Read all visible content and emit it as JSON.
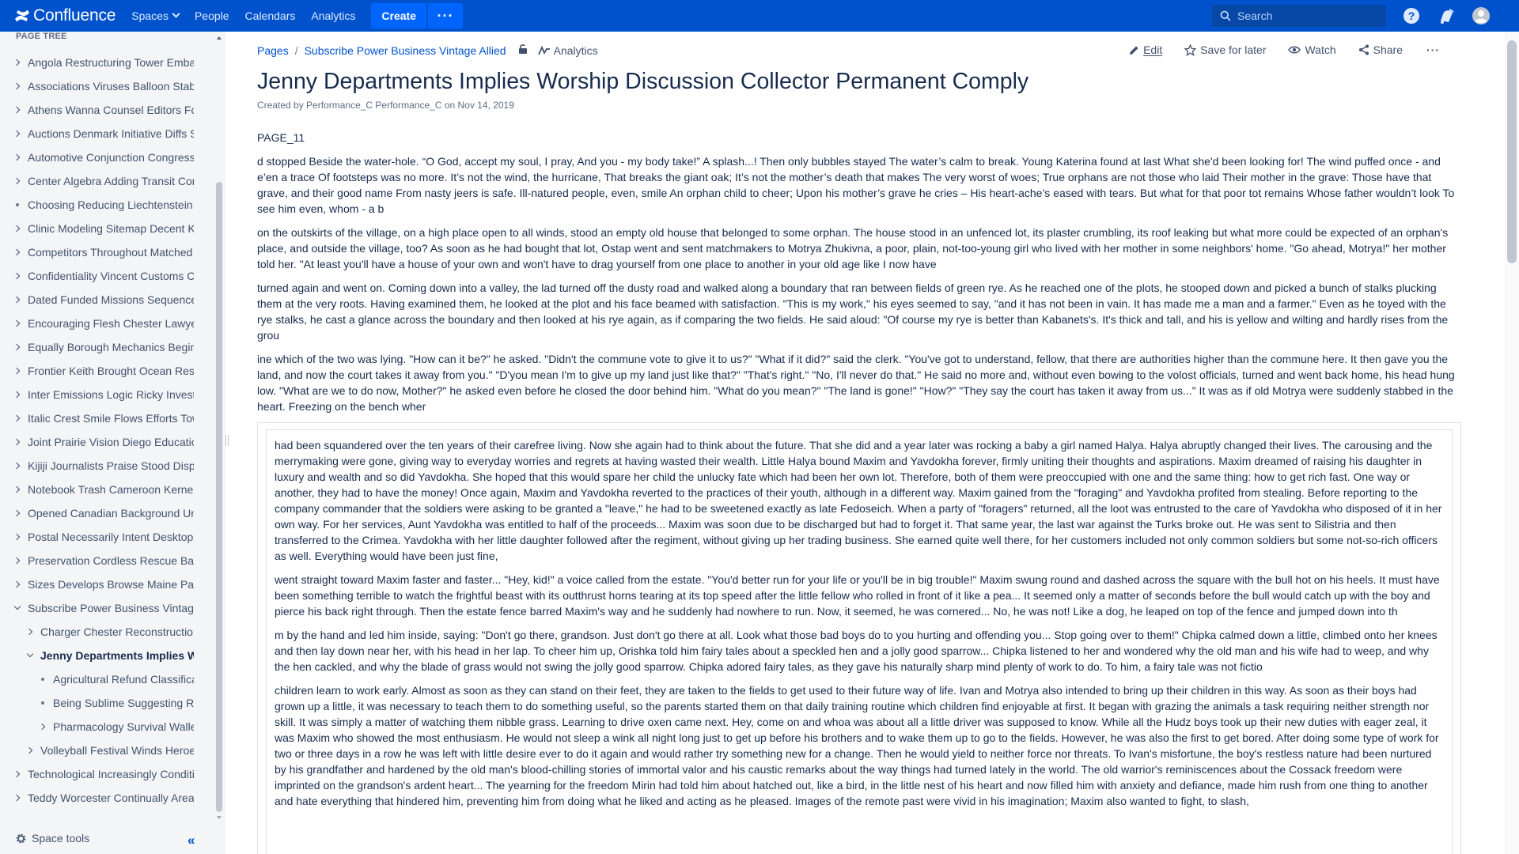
{
  "topnav": {
    "logo": "Confluence",
    "spaces": "Spaces",
    "people": "People",
    "calendars": "Calendars",
    "analytics": "Analytics",
    "create": "Create",
    "more": "···",
    "search_placeholder": "Search"
  },
  "sidebar": {
    "header": "PAGE TREE",
    "items": [
      {
        "label": "Angola Restructuring Tower Embassy",
        "state": "closed",
        "level": 0
      },
      {
        "label": "Associations Viruses Balloon Stable",
        "state": "closed",
        "level": 0
      },
      {
        "label": "Athens Wanna Counsel Editors Focus",
        "state": "closed",
        "level": 0
      },
      {
        "label": "Auctions Denmark Initiative Diffs Seen",
        "state": "closed",
        "level": 0
      },
      {
        "label": "Automotive Conjunction Congressional",
        "state": "closed",
        "level": 0
      },
      {
        "label": "Center Algebra Adding Transit Core",
        "state": "closed",
        "level": 0
      },
      {
        "label": "Choosing Reducing Liechtenstein Seen",
        "state": "leaf",
        "level": 0
      },
      {
        "label": "Clinic Modeling Sitemap Decent Kit",
        "state": "closed",
        "level": 0
      },
      {
        "label": "Competitors Throughout Matched Sun",
        "state": "closed",
        "level": 0
      },
      {
        "label": "Confidentiality Vincent Customs Chad",
        "state": "closed",
        "level": 0
      },
      {
        "label": "Dated Funded Missions Sequence Log",
        "state": "closed",
        "level": 0
      },
      {
        "label": "Encouraging Flesh Chester Lawyers",
        "state": "closed",
        "level": 0
      },
      {
        "label": "Equally Borough Mechanics Beginning",
        "state": "closed",
        "level": 0
      },
      {
        "label": "Frontier Keith Brought Ocean Result",
        "state": "closed",
        "level": 0
      },
      {
        "label": "Inter Emissions Logic Ricky Investor",
        "state": "closed",
        "level": 0
      },
      {
        "label": "Italic Crest Smile Flows Efforts Town",
        "state": "closed",
        "level": 0
      },
      {
        "label": "Joint Prairie Vision Diego Education",
        "state": "closed",
        "level": 0
      },
      {
        "label": "Kijiji Journalists Praise Stood Display",
        "state": "closed",
        "level": 0
      },
      {
        "label": "Notebook Trash Cameroon Kernel Tip",
        "state": "closed",
        "level": 0
      },
      {
        "label": "Opened Canadian Background Union",
        "state": "closed",
        "level": 0
      },
      {
        "label": "Postal Necessarily Intent Desktop Bay",
        "state": "closed",
        "level": 0
      },
      {
        "label": "Preservation Cordless Rescue Basket",
        "state": "closed",
        "level": 0
      },
      {
        "label": "Sizes Develops Browse Maine Palace",
        "state": "closed",
        "level": 0
      },
      {
        "label": "Subscribe Power Business Vintage Allied",
        "state": "open",
        "level": 0
      },
      {
        "label": "Charger Chester Reconstruction Ran",
        "state": "closed",
        "level": 1
      },
      {
        "label": "Jenny Departments Implies Worship",
        "state": "open",
        "level": 1,
        "current": true
      },
      {
        "label": "Agricultural Refund Classification",
        "state": "leaf",
        "level": 2
      },
      {
        "label": "Being Sublime Suggesting Retained",
        "state": "leaf",
        "level": 2
      },
      {
        "label": "Pharmacology Survival Wallet Doc",
        "state": "closed",
        "level": 2
      },
      {
        "label": "Volleyball Festival Winds Heroes",
        "state": "closed",
        "level": 1
      },
      {
        "label": "Technological Increasingly Conditions",
        "state": "closed",
        "level": 0
      },
      {
        "label": "Teddy Worcester Continually Areas",
        "state": "closed",
        "level": 0
      }
    ],
    "space_tools": "Space tools",
    "collapse": "«"
  },
  "breadcrumb": {
    "pages": "Pages",
    "separator": "/",
    "parent": "Subscribe Power Business Vintage Allied",
    "analytics": "Analytics"
  },
  "page_actions": {
    "edit": "Edit",
    "save": "Save for later",
    "watch": "Watch",
    "share": "Share",
    "more": "···"
  },
  "page": {
    "title": "Jenny Departments Implies Worship Discussion Collector Permanent Comply",
    "byline_prefix": "Created by",
    "author": "Performance_C Performance_C",
    "byline_on": "on",
    "date": "Nov 14, 2019",
    "paragraphs": [
      "PAGE_11",
      "d stopped Beside the water-hole. “O God, accept my soul, I pray, And you - my body take!” A splash...! Then only bubbles stayed The water’s calm to break. Young Katerina found at last What she'd been looking for! The wind puffed once - and e’en a trace Of footsteps was no more. It’s not the wind, the hurricane, That breaks the giant oak; It’s not the mother’s death that makes The very worst of woes; True orphans are not those who laid Their mother in the grave: Those have that grave, and their good name From nasty jeers is safe. Ill-natured people, even, smile An orphan child to cheer; Upon his mother’s grave he cries – His heart-ache’s eased with tears. But what for that poor tot remains Whose father wouldn’t look To see him even, whom - a b",
      "on the outskirts of the village, on a high place open to all winds, stood an empty old house that belonged to some orphan. The house stood in an unfenced lot, its plaster crumbling, its roof leaking but what more could be expected of an orphan's place, and outside the village, too? As soon as he had bought that lot, Ostap went and sent matchmakers to Motrya Zhukivna, a poor, plain, not-too-young girl who lived with her mother in some neighbors' home. \"Go ahead, Motrya!\" her mother told her. \"At least you'll have a house of your own and won't have to drag yourself from one place to another in your old age like I now have",
      "turned again and went on. Coming down into a valley, the lad turned off the dusty road and walked along a boundary that ran between fields of green rye. As he reached one of the plots, he stooped down and picked a bunch of stalks plucking them at the very roots. Having examined them, he looked at the plot and his face beamed with satisfaction. \"This is my work,\" his eyes seemed to say, \"and it has not been in vain. It has made me a man and a farmer.\" Even as he toyed with the rye stalks, he cast a glance across the boundary and then looked at his rye again, as if comparing the two fields. He said aloud: \"Of course my rye is better than Kabanets's. It's thick and tall, and his is yellow and wilting and hardly rises from the grou",
      "ine which of the two was lying. \"How can it be?\" he asked. \"Didn't the commune vote to give it to us?\" \"What if it did?\" said the clerk. \"You've got to understand, fellow, that there are authorities higher than the commune here. It then gave you the land, and now the court takes it away from you.\" \"D'you mean I'm to give up my land just like that?\" \"That's right.\" \"No, I'll never do that.\" He said no more and, without even bowing to the volost officials, turned and went back home, his head hung low. \"What are we to do now, Mother?\" he asked even before he closed the door behind him. \"What do you mean?\" \"The land is gone!\" \"How?\" \"They say the court has taken it away from us...\" It was as if old Motrya were suddenly stabbed in the heart. Freezing on the bench wher"
    ],
    "panel_paragraphs": [
      "had been squandered over the ten years of their carefree living. Now she again had to think about the future. That she did and a year later was rocking a baby a girl named Halya. Halya abruptly changed their lives. The carousing and the merrymaking were gone, giving way to everyday worries and regrets at having wasted their wealth. Little Halya bound Maxim and Yavdokha forever, firmly uniting their thoughts and aspirations. Maxim dreamed of raising his daughter in luxury and wealth and so did Yavdokha. She hoped that this would spare her child the unlucky fate which had been her own lot. Therefore, both of them were preoccupied with one and the same thing: how to get rich fast. One way or another, they had to have the money! Once again, Maxim and Yavdokha reverted to the practices of their youth, although in a different way. Maxim gained from the \"foraging\" and Yavdokha profited from stealing. Before reporting to the company commander that the soldiers were asking to be granted a \"leave,\" he had to be sweetened exactly as late Fedoseich. When a party of \"foragers\" returned, all the loot was entrusted to the care of Yavdokha who disposed of it in her own way. For her services, Aunt Yavdokha was entitled to half of the proceeds... Maxim was soon due to be discharged but had to forget it. That same year, the last war against the Turks broke out. He was sent to Silistria and then transferred to the Crimea. Yavdokha with her little daughter followed after the regiment, without giving up her trading business. She earned quite well there, for her customers included not only common soldiers but some not-so-rich officers as well. Everything would have been just fine,",
      "went straight toward Maxim faster and faster... \"Hey, kid!\" a voice called from the estate. \"You'd better run for your life or you'll be in big trouble!\" Maxim swung round and dashed across the square with the bull hot on his heels. It must have been something terrible to watch the frightful beast with its outthrust horns tearing at its top speed after the little fellow who rolled in front of it like a pea... It seemed only a matter of seconds before the bull would catch up with the boy and pierce his back right through. Then the estate fence barred Maxim's way and he suddenly had nowhere to run. Now, it seemed, he was cornered... No, he was not! Like a dog, he leaped on top of the fence and jumped down into th",
      "m by the hand and led him inside, saying: \"Don't go there, grandson. Just don't go there at all. Look what those bad boys do to you hurting and offending you... Stop going over to them!\" Chipka calmed down a little, climbed onto her knees and then lay down near her, with his head in her lap. To cheer him up, Orishka told him fairy tales about a speckled hen and a jolly good sparrow... Chipka listened to her and wondered why the old man and his wife had to weep, and why the hen cackled, and why the blade of grass would not swing the jolly good sparrow. Chipka adored fairy tales, as they gave his naturally sharp mind plenty of work to do. To him, a fairy tale was not fictio",
      "children learn to work early. Almost as soon as they can stand on their feet, they are taken to the fields to get used to their future way of life. Ivan and Motrya also intended to bring up their children in this way. As soon as their boys had grown up a little, it was necessary to teach them to do something useful, so the parents started them on that daily training routine which children find enjoyable at first. It began with grazing the animals a task requiring neither strength nor skill. It was simply a matter of watching them nibble grass. Learning to drive oxen came next. Hey, come on and whoa was about all a little driver was supposed to know. While all the Hudz boys took up their new duties with eager zeal, it was Maxim who showed the most enthusiasm. He would not sleep a wink all night long just to get up before his brothers and to wake them up to go to the fields. However, he was also the first to get bored. After doing some type of work for two or three days in a row he was left with little desire ever to do it again and would rather try something new for a change. Then he would yield to neither force nor threats. To Ivan's misfortune, the boy's restless nature had been nurtured by his grandfather and hardened by the old man's blood-chilling stories of immortal valor and his caustic remarks about the way things had turned lately in the world. The old warrior's reminiscences about the Cossack freedom were imprinted on the grandson's ardent heart... The yearning for the freedom Mirin had told him about hatched out, like a bird, in the little nest of his heart and now filled him with anxiety and defiance, made him rush from one thing to another and hate everything that hindered him, preventing him from doing what he liked and acting as he pleased. Images of the remote past were vivid in his imagination; Maxim also wanted to fight, to slash,"
    ]
  },
  "colors": {
    "nav_bg": "#0052cc",
    "link": "#0052cc",
    "sidebar_bg": "#f4f5f7"
  }
}
